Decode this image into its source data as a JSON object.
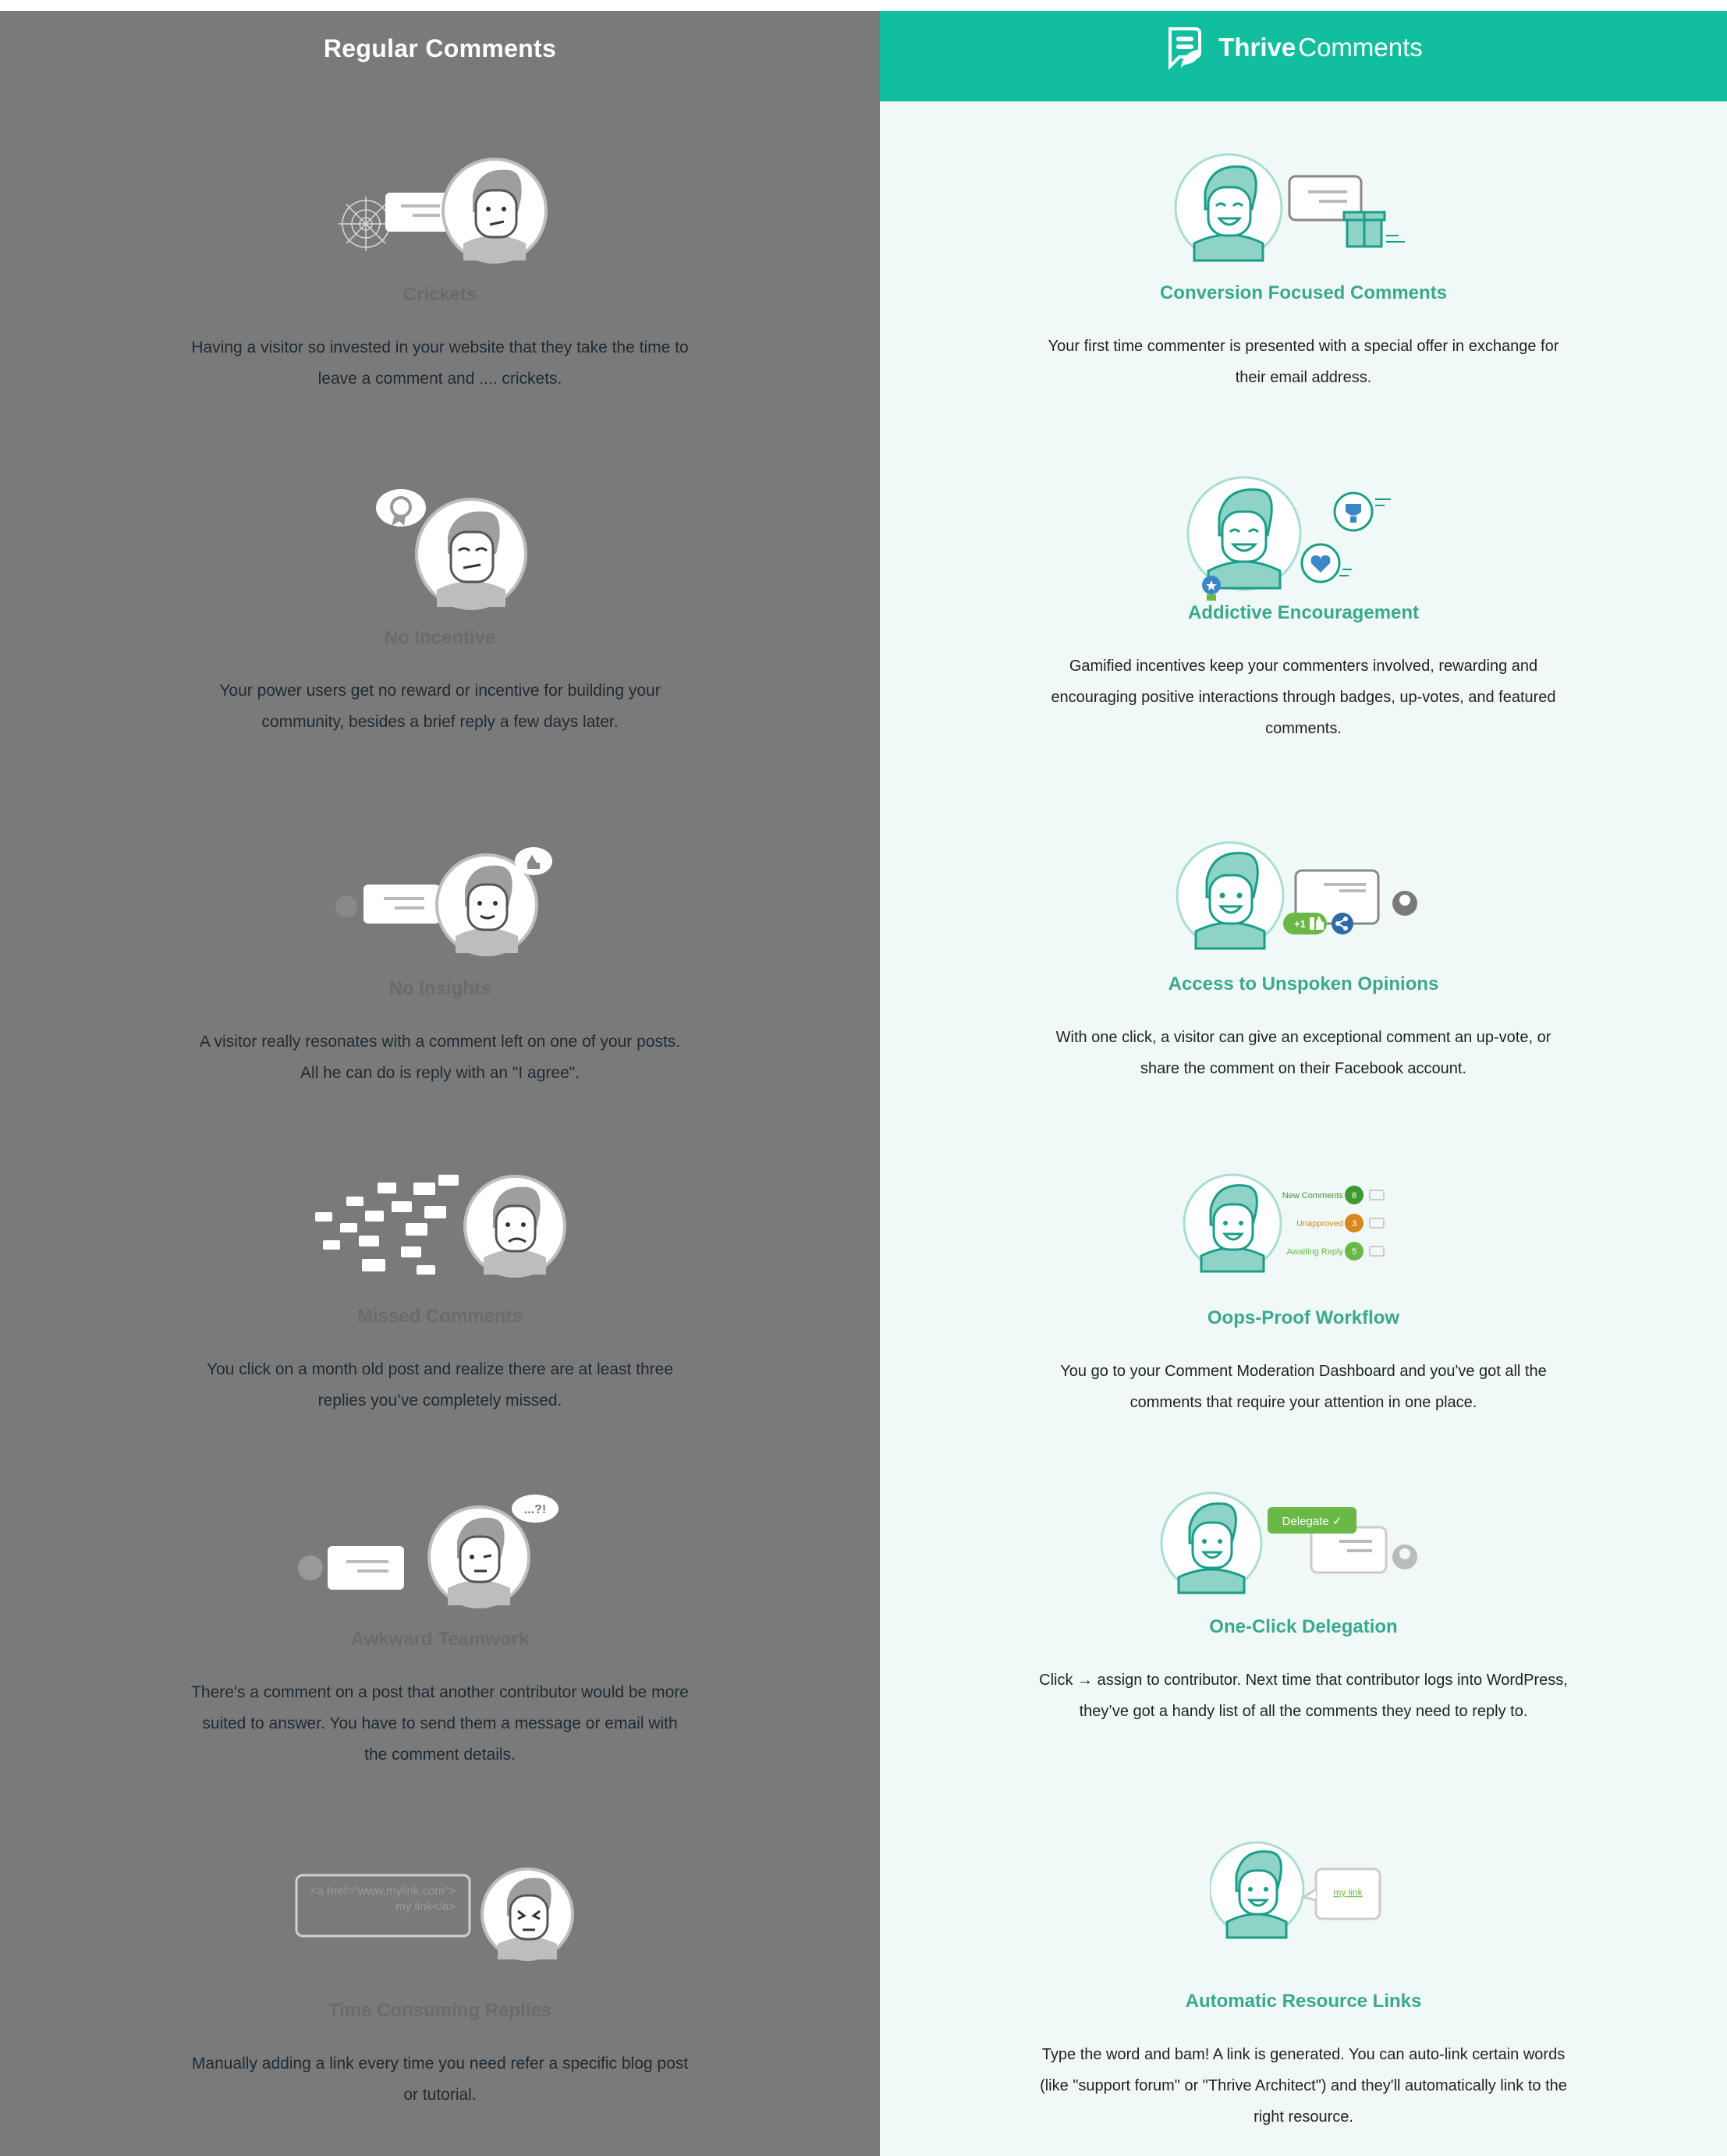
{
  "left": {
    "header": {
      "title": "Regular Comments"
    },
    "items": [
      {
        "title": "Crickets",
        "description": "Having a visitor so invested in your website that they take the time to leave a comment and .... crickets.",
        "illustration": "spiderweb-speech-bubble-icon"
      },
      {
        "title": "No Incentive",
        "description": "Your power users get no reward or incentive for building your community, besides a brief reply a few days later.",
        "illustration": "award-thought-bubble-icon"
      },
      {
        "title": "No Insights",
        "description": "A visitor really resonates with a comment left on one of your posts. All he can do is reply with an \"I agree\".",
        "illustration": "thumbs-up-bubble-icon"
      },
      {
        "title": "Missed Comments",
        "description": "You click on a month old post and realize there are at least three replies you’ve completely missed.",
        "illustration": "scattered-comments-icon"
      },
      {
        "title": "Awkward Teamwork",
        "description": "There's a comment on a post that another contributor would be more suited to answer. You have to send them a message or email with the comment details.",
        "illustration": "confused-bubble-icon",
        "bubble_text": "...?!"
      },
      {
        "title": "Time Consuming Replies",
        "description": "Manually adding a link every time you need refer a specific blog post or tutorial.",
        "illustration": "html-link-bubble-icon",
        "code_line1": "<a href=\"www.mylink.com\">",
        "code_line2": "my link</a>"
      }
    ]
  },
  "right": {
    "header": {
      "brand_bold": "Thrive",
      "brand_regular": "Comments",
      "logo": "thrive-comments-logo-icon"
    },
    "accent": "#11bf9f",
    "items": [
      {
        "title": "Conversion Focused Comments",
        "description": "Your first time commenter is presented with a special offer in exchange for their email address.",
        "illustration": "gift-offer-icon"
      },
      {
        "title": "Addictive Encouragement",
        "description": "Gamified incentives keep your commenters involved, rewarding and encouraging positive interactions through badges, up-votes, and featured comments.",
        "illustration": "trophy-heart-badge-icon"
      },
      {
        "title": "Access to Unspoken Opinions",
        "description": "With one click, a visitor can give an exceptional comment an up-vote, or share the comment on their Facebook account.",
        "illustration": "upvote-share-icon",
        "upvote_label": "+1"
      },
      {
        "title": "Oops-Proof Workflow",
        "description": "You go to your Comment Moderation Dashboard and you've got all the comments that require your attention in one place.",
        "illustration": "moderation-dashboard-icon",
        "stats": [
          {
            "label": "New Comments",
            "count": "8",
            "color": "#3e9a2e"
          },
          {
            "label": "Unapproved",
            "count": "3",
            "color": "#d8861e"
          },
          {
            "label": "Awaiting Reply",
            "count": "5",
            "color": "#6ab845"
          }
        ]
      },
      {
        "title": "One-Click Delegation",
        "description": "Click → assign to contributor. Next time that contributor logs into WordPress, they’ve got a handy list of all the comments they need to reply to.",
        "illustration": "delegate-icon",
        "delegate_label": "Delegate ✓"
      },
      {
        "title": "Automatic Resource Links",
        "description": "Type the word and bam! A link is generated. You can auto-link certain words (like \"support forum\" or \"Thrive Architect\") and they'll automatically link to the right resource.",
        "illustration": "auto-link-icon",
        "link_label": "my link"
      }
    ]
  }
}
